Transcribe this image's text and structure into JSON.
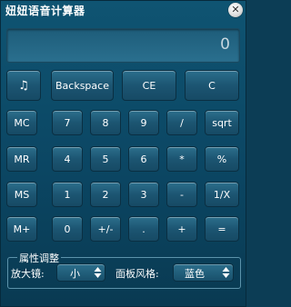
{
  "window": {
    "title": "妞妞语音计算器"
  },
  "display": {
    "value": "0"
  },
  "buttons": {
    "row1": [
      "Backspace",
      "CE",
      "C"
    ],
    "row2": [
      "MC",
      "7",
      "8",
      "9",
      "/",
      "sqrt"
    ],
    "row3": [
      "MR",
      "4",
      "5",
      "6",
      "*",
      "%"
    ],
    "row4": [
      "MS",
      "1",
      "2",
      "3",
      "-",
      "1/X"
    ],
    "row5": [
      "M+",
      "0",
      "+/-",
      ".",
      "+",
      "="
    ]
  },
  "icons": {
    "sound": "music-note-icon",
    "close": "close-icon"
  },
  "properties": {
    "legend": "属性调整",
    "zoom_label": "放大镜:",
    "zoom_value": "小",
    "style_label": "面板风格:",
    "style_value": "蓝色"
  },
  "colors": {
    "window_bg": "#0f5472",
    "button_bg": "#1c5572",
    "text": "#ffffff"
  }
}
